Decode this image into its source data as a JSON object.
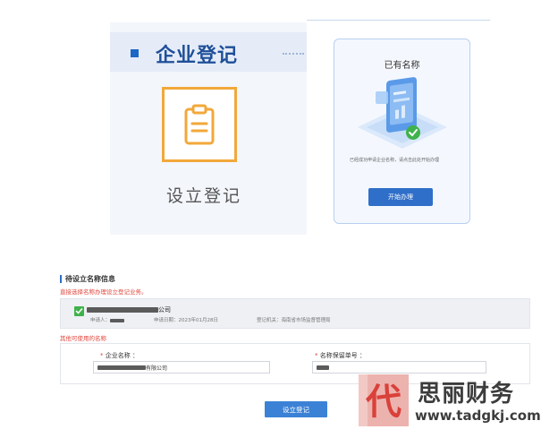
{
  "registration_card": {
    "title": "企业登记",
    "option_label": "设立登记",
    "icon": "clipboard-icon"
  },
  "existing_name_card": {
    "title": "已有名称",
    "description": "已经成功申请企业名称，请点击此处开始办理",
    "button_label": "开始办理",
    "illustration": "phone-check-illustration"
  },
  "pending_section": {
    "title": "待设立名称信息",
    "hint": "直接选择名称办理设立登记业务。",
    "item": {
      "company_name_suffix": "公司",
      "applicant_label": "申请人：",
      "apply_date": "申请日期：2023年01月28日",
      "registration_org": "登记机关：海南省市场监督管理局"
    }
  },
  "other_names": {
    "title": "其他可使用的名称",
    "company_name_label": "企业名称 ：",
    "company_name_value_suffix": "有限公司",
    "reservation_label": "名称保留单号 ："
  },
  "submit_button": "设立登记",
  "watermark": {
    "logo_char": "代",
    "brand": "思丽财务",
    "url": "www.tadgkj.com"
  },
  "colors": {
    "primary": "#2f6fc9",
    "required": "#e0453a",
    "accent_orange": "#f2a83a",
    "check_green": "#3fb24b",
    "watermark_red": "#d9413a"
  }
}
